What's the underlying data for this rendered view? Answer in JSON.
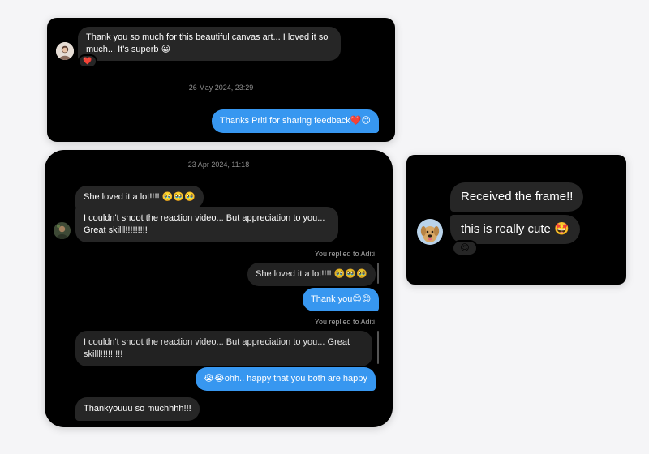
{
  "card1": {
    "incoming_message": "Thank you so much for this beautiful canvas art... I loved it so much... It's superb 😀",
    "reaction": "❤️",
    "timestamp": "26 May 2024, 23:29",
    "outgoing_message": "Thanks Priti for sharing feedback❤️😊"
  },
  "card2": {
    "timestamp": "23 Apr 2024, 11:18",
    "msg1": "She loved it a lot!!!! 🥹🥹🥹",
    "msg2": "I couldn't shoot the reaction video... But appreciation to you... Great skilll!!!!!!!!!",
    "replied_label_1": "You replied to Aditi",
    "quoted_1": "She loved it a lot!!!! 🥹🥹🥹",
    "reply_1": "Thank you😊😊",
    "replied_label_2": "You replied to Aditi",
    "quoted_2": "I couldn't shoot the reaction video... But appreciation to you... Great skilll!!!!!!!!!",
    "reply_2": "😭😭ohh.. happy that you both are happy",
    "msg3": "Thankyouuu so muchhhh!!!"
  },
  "card3": {
    "msg1": "Received the frame!!",
    "msg2": "this is really cute 🤩",
    "reaction": "😍"
  },
  "colors": {
    "panel": "#000000",
    "incoming_bubble": "#262626",
    "outgoing_bubble": "#3797f0",
    "background": "#f5f5f7"
  }
}
